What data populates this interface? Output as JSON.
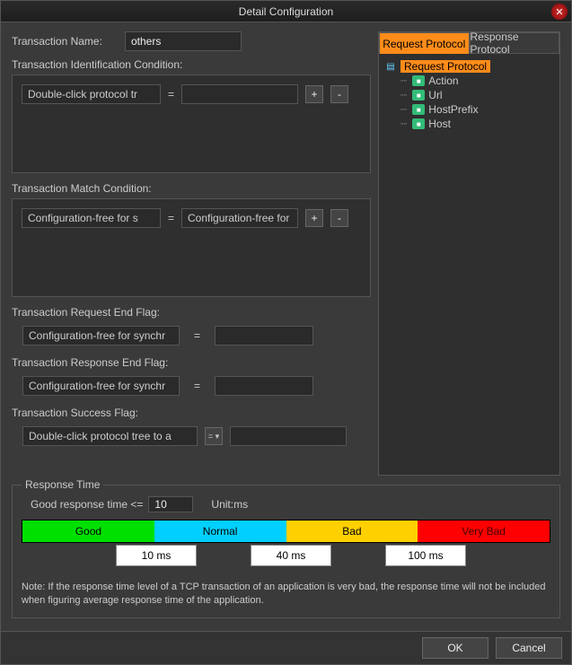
{
  "title": "Detail Configuration",
  "transaction_name": {
    "label": "Transaction Name:",
    "value": "others"
  },
  "ident_condition": {
    "label": "Transaction Identification Condition:",
    "left_placeholder": "Double-click protocol tr",
    "right_value": "",
    "add": "+",
    "remove": "-"
  },
  "match_condition": {
    "label": "Transaction Match Condition:",
    "left_placeholder": "Configuration-free for s",
    "right_placeholder": "Configuration-free for s",
    "add": "+",
    "remove": "-"
  },
  "req_end_flag": {
    "label": "Transaction Request End Flag:",
    "left_placeholder": "Configuration-free for synchr",
    "right_value": ""
  },
  "resp_end_flag": {
    "label": "Transaction Response End Flag:",
    "left_placeholder": "Configuration-free for synchr",
    "right_value": ""
  },
  "success_flag": {
    "label": "Transaction Success Flag:",
    "left_placeholder": "Double-click protocol tree to a",
    "op": "=",
    "right_value": ""
  },
  "tabs": {
    "request": "Request Protocol",
    "response": "Response Protocol"
  },
  "tree": {
    "root": "Request Protocol",
    "children": [
      "Action",
      "Url",
      "HostPrefix",
      "Host"
    ]
  },
  "response_time": {
    "legend": "Response Time",
    "good_label": "Good response time <=",
    "good_value": "10",
    "unit": "Unit:ms",
    "bars": {
      "good": "Good",
      "normal": "Normal",
      "bad": "Bad",
      "vbad": "Very Bad"
    },
    "thresholds": [
      "10 ms",
      "40 ms",
      "100 ms"
    ],
    "note": "Note: If the response time level of a TCP transaction of an application is very bad, the response time will not be included when figuring average response time of the application."
  },
  "buttons": {
    "ok": "OK",
    "cancel": "Cancel"
  },
  "eq": "="
}
